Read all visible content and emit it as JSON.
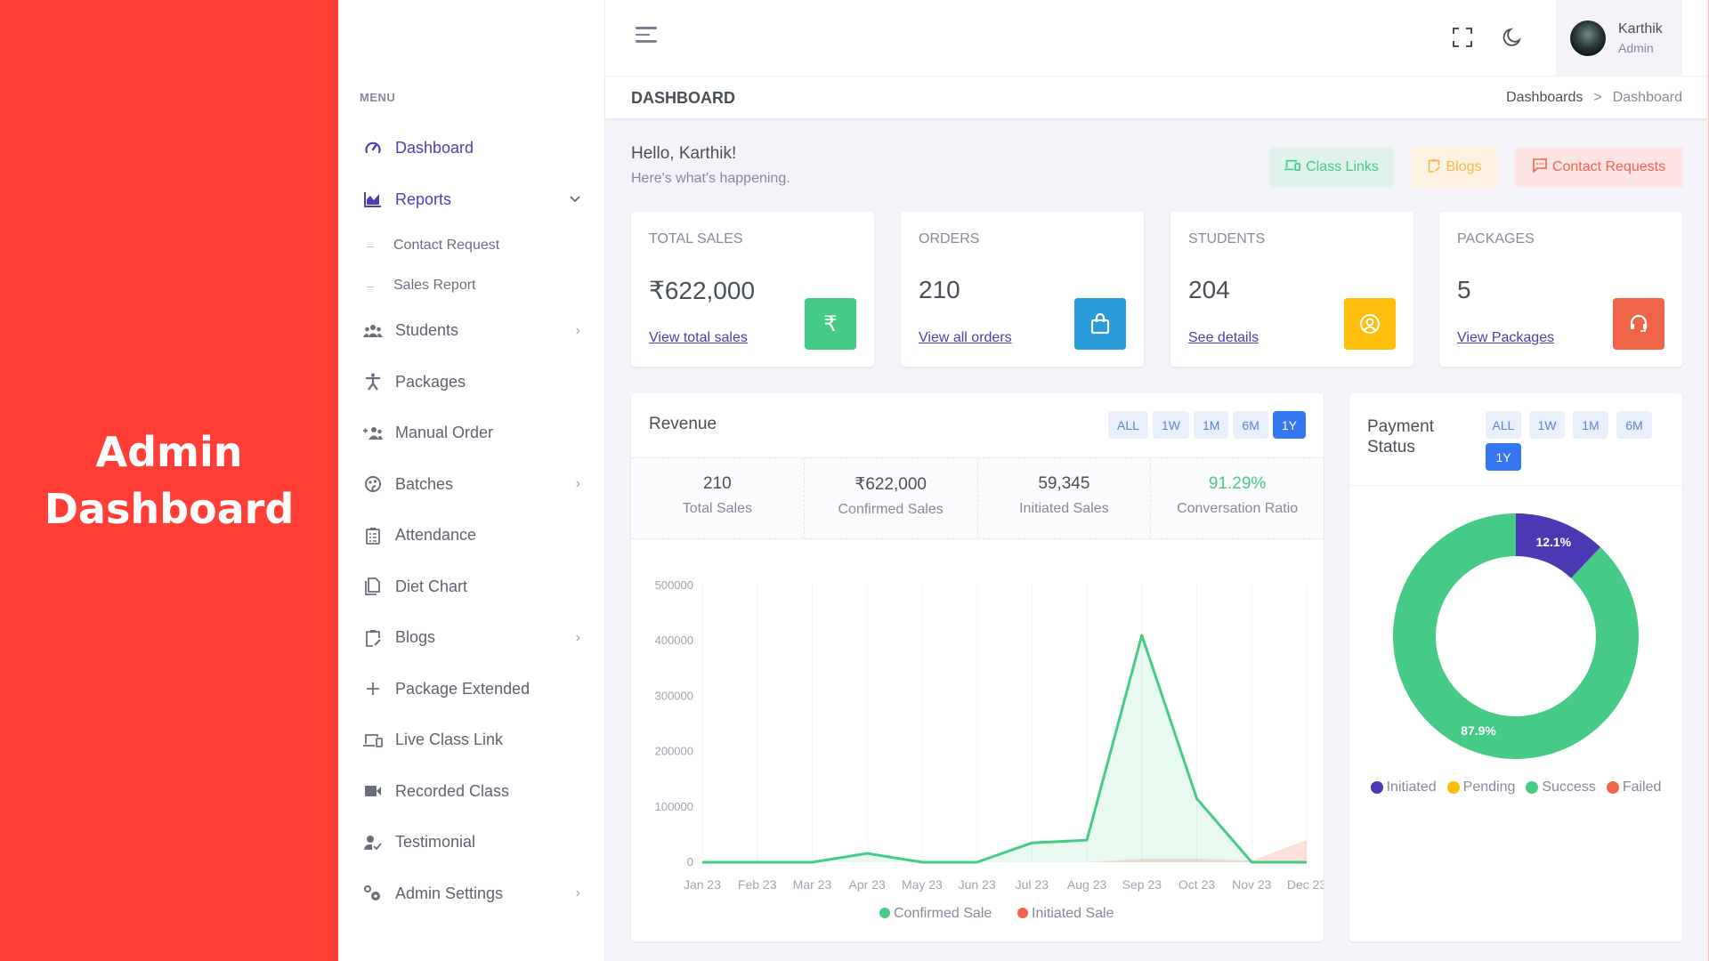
{
  "promo": {
    "title_line1": "Admin",
    "title_line2": "Dashboard",
    "background": "#ff3f35"
  },
  "sidebar": {
    "menu_title": "MENU",
    "items": [
      {
        "label": "Dashboard",
        "icon": "dashboard-gauge-icon",
        "active": true
      },
      {
        "label": "Reports",
        "icon": "chart-area-icon",
        "active": true,
        "expanded": true,
        "children": [
          {
            "label": "Contact Request"
          },
          {
            "label": "Sales Report"
          }
        ]
      },
      {
        "label": "Students",
        "icon": "users-group-icon",
        "has_children": true
      },
      {
        "label": "Packages",
        "icon": "person-accessibility-icon"
      },
      {
        "label": "Manual Order",
        "icon": "user-add-group-icon"
      },
      {
        "label": "Batches",
        "icon": "palette-icon",
        "has_children": true
      },
      {
        "label": "Attendance",
        "icon": "clipboard-list-icon"
      },
      {
        "label": "Diet Chart",
        "icon": "pages-icon"
      },
      {
        "label": "Blogs",
        "icon": "clipboard-edit-icon",
        "has_children": true
      },
      {
        "label": "Package Extended",
        "icon": "plus-icon"
      },
      {
        "label": "Live Class Link",
        "icon": "devices-icon"
      },
      {
        "label": "Recorded Class",
        "icon": "video-camera-icon"
      },
      {
        "label": "Testimonial",
        "icon": "user-check-icon"
      },
      {
        "label": "Admin Settings",
        "icon": "settings-gears-icon",
        "has_children": true
      }
    ]
  },
  "topbar": {
    "user": {
      "name": "Karthik",
      "role": "Admin"
    }
  },
  "page": {
    "title": "DASHBOARD",
    "breadcrumb": [
      "Dashboards",
      "Dashboard"
    ],
    "breadcrumb_sep": ">"
  },
  "greeting": {
    "title": "Hello, Karthik!",
    "subtitle": "Here's what's happening."
  },
  "quick_links": [
    {
      "label": "Class Links",
      "icon": "devices-icon",
      "color": "#45cb85"
    },
    {
      "label": "Blogs",
      "icon": "clipboard-edit-icon",
      "color": "#f7b84b"
    },
    {
      "label": "Contact Requests",
      "icon": "message-icon",
      "color": "#f06548"
    }
  ],
  "stats": [
    {
      "label": "TOTAL SALES",
      "value": "₹622,000",
      "link": "View total sales",
      "icon": "rupee-icon",
      "color": "#45cb85"
    },
    {
      "label": "ORDERS",
      "value": "210",
      "link": "View all orders",
      "icon": "shopping-bag-icon",
      "color": "#299cdb"
    },
    {
      "label": "STUDENTS",
      "value": "204",
      "link": "See details",
      "icon": "user-circle-icon",
      "color": "#ffbe0b"
    },
    {
      "label": "PACKAGES",
      "value": "5",
      "link": "View Packages",
      "icon": "headset-icon",
      "color": "#f06548"
    }
  ],
  "revenue": {
    "title": "Revenue",
    "ranges": [
      "ALL",
      "1W",
      "1M",
      "6M",
      "1Y"
    ],
    "active_range": "1Y",
    "kpis": [
      {
        "value": "210",
        "label": "Total Sales"
      },
      {
        "value": "₹622,000",
        "label": "Confirmed Sales"
      },
      {
        "value": "59,345",
        "label": "Initiated Sales"
      },
      {
        "value": "91.29%",
        "label": "Conversation Ratio",
        "highlight": true
      }
    ]
  },
  "payment": {
    "title": "Payment Status",
    "ranges": [
      "ALL",
      "1W",
      "1M",
      "6M",
      "1Y"
    ],
    "active_range": "1Y"
  },
  "chart_data": [
    {
      "type": "area",
      "title": "Revenue",
      "categories": [
        "Jan 23",
        "Feb 23",
        "Mar 23",
        "Apr 23",
        "May 23",
        "Jun 23",
        "Jul 23",
        "Aug 23",
        "Sep 23",
        "Oct 23",
        "Nov 23",
        "Dec 23"
      ],
      "yticks": [
        0,
        100000,
        200000,
        300000,
        400000,
        500000
      ],
      "ylim": [
        0,
        500000
      ],
      "xlabel": "",
      "ylabel": "",
      "grid": "vertical",
      "legend_position": "bottom",
      "series": [
        {
          "name": "Confirmed Sale",
          "color": "#45cb85",
          "values": [
            0,
            0,
            0,
            16000,
            0,
            0,
            35000,
            40000,
            410000,
            115000,
            0,
            0
          ]
        },
        {
          "name": "Initiated Sale",
          "color": "#f06548",
          "values": [
            0,
            0,
            0,
            0,
            0,
            0,
            0,
            0,
            6000,
            6000,
            3000,
            40000
          ]
        }
      ]
    },
    {
      "type": "pie",
      "title": "Payment Status",
      "donut": true,
      "legend_position": "bottom",
      "slices": [
        {
          "name": "Initiated",
          "value": 12.1,
          "color": "#4b38b3",
          "label": "12.1%"
        },
        {
          "name": "Pending",
          "value": 0,
          "color": "#ffbe0b",
          "label": ""
        },
        {
          "name": "Success",
          "value": 87.9,
          "color": "#45cb85",
          "label": "87.9%"
        },
        {
          "name": "Failed",
          "value": 0,
          "color": "#f06548",
          "label": ""
        }
      ]
    }
  ]
}
